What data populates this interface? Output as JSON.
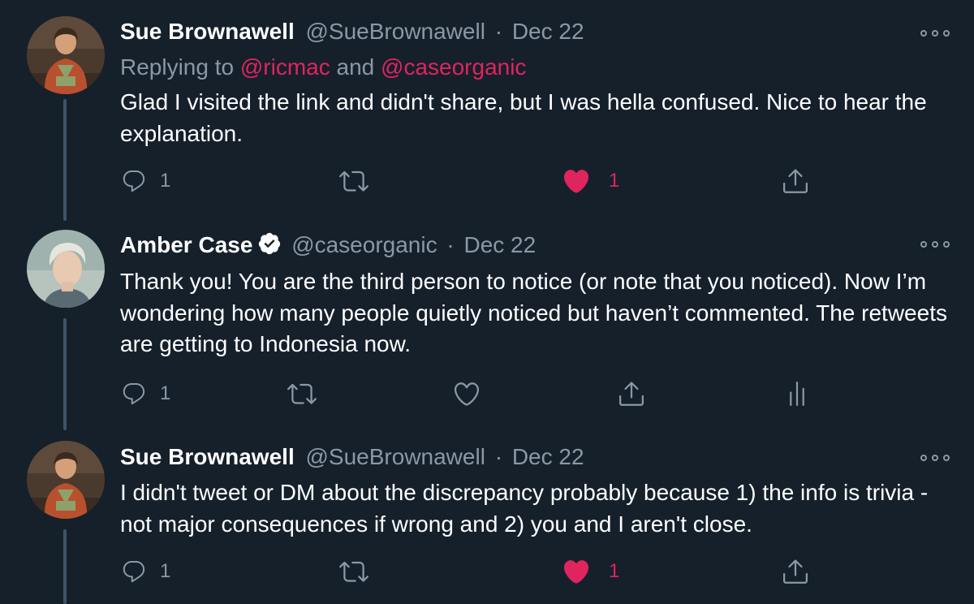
{
  "tweets": [
    {
      "name": "Sue Brownawell",
      "handle": "@SueBrownawell",
      "dot": "·",
      "date": "Dec 22",
      "reply_prefix": "Replying to ",
      "reply_mention_1": "@ricmac",
      "reply_and": " and ",
      "reply_mention_2": "@caseorganic",
      "text": "Glad I visited the link and didn't share, but I was hella confused. Nice to hear the explanation.",
      "reply_count": "1",
      "like_count": "1",
      "liked": true
    },
    {
      "name": "Amber Case",
      "verified": true,
      "handle": "@caseorganic",
      "dot": "·",
      "date": "Dec 22",
      "text": "Thank you! You are the third person to notice (or note that you noticed). Now I’m wondering how many people quietly noticed but haven’t commented. The retweets are getting to Indonesia now.",
      "reply_count": "1",
      "liked": false
    },
    {
      "name": "Sue Brownawell",
      "handle": "@SueBrownawell",
      "dot": "·",
      "date": "Dec 22",
      "text": "I didn't tweet or DM about the discrepancy probably because 1) the info is trivia - not major consequences if wrong and 2) you and I aren't close.",
      "reply_count": "1",
      "like_count": "1",
      "liked": true
    }
  ],
  "colors": {
    "background": "#15202b",
    "secondary_text": "#8b98a5",
    "like": "#e0245e",
    "mention": "#e0245e",
    "thread_line": "#3d5466",
    "verified": "#ffffff"
  },
  "icons": [
    "reply-icon",
    "retweet-icon",
    "like-icon",
    "share-icon",
    "analytics-icon",
    "more-icon",
    "verified-icon"
  ]
}
